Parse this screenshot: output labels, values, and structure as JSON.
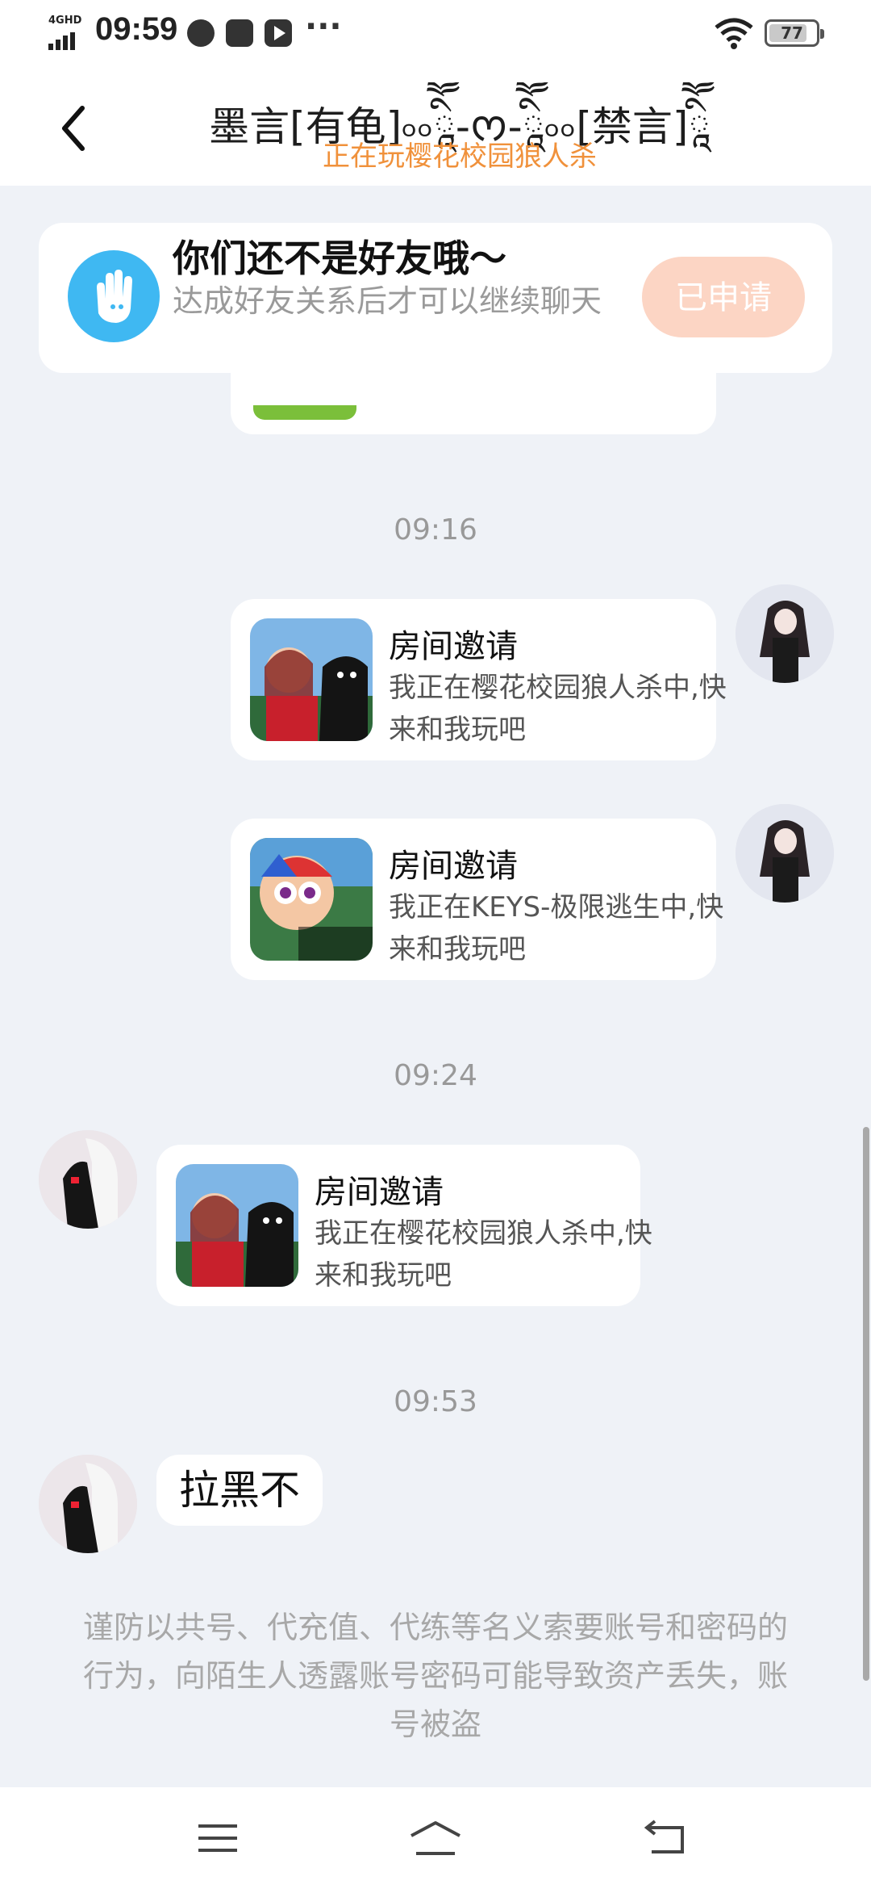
{
  "status_bar": {
    "network": "4GHD",
    "time": "09:59",
    "more": "···",
    "battery": "77"
  },
  "header": {
    "title": "墨言[有龟]৹৹ཱིཽ-ᰔ-ཱིཽ৹৹[禁言]ཱིཽ",
    "subtitle": "正在玩樱花校园狼人杀"
  },
  "friend_notice": {
    "title": "你们还不是好友哦～",
    "description": "达成好友关系后才可以继续聊天",
    "button_label": "已申请"
  },
  "messages": {
    "time_1": "09:16",
    "invite_1": {
      "title": "房间邀请",
      "text": "我正在樱花校园狼人杀中,快来和我玩吧"
    },
    "invite_2": {
      "title": "房间邀请",
      "text": "我正在KEYS-极限逃生中,快来和我玩吧"
    },
    "time_2": "09:24",
    "invite_3": {
      "title": "房间邀请",
      "text": "我正在樱花校园狼人杀中,快来和我玩吧"
    },
    "time_3": "09:53",
    "text_1": "拉黑不"
  },
  "warning": "谨防以共号、代充值、代练等名义索要账号和密码的行为，向陌生人透露账号密码可能导致资产丢失，账号被盗",
  "colors": {
    "accent_orange": "#f0913b",
    "applied_button": "#fcd5c4",
    "notice_icon": "#3fb8f2",
    "background": "#eff2f7"
  },
  "icons": {
    "back": "chevron-left-icon",
    "hand": "hand-wave-icon",
    "menu": "menu-icon",
    "home": "home-icon",
    "return": "back-arrow-icon"
  }
}
